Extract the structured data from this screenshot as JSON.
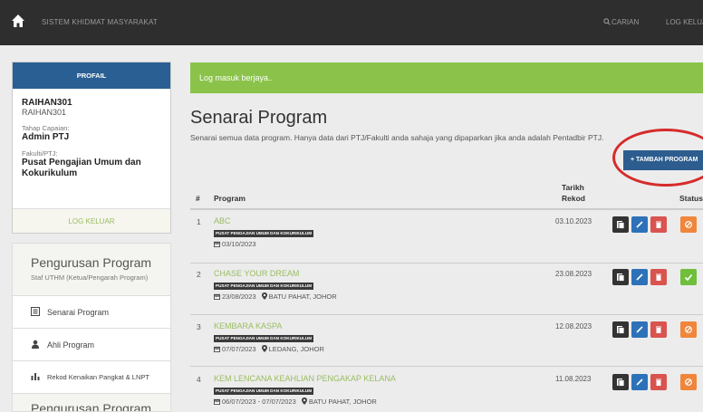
{
  "navbar": {
    "brand": "SISTEM KHIDMAT MASYARAKAT",
    "search_label": "CARIAN",
    "logout_label": "LOG KELUAR"
  },
  "profile": {
    "header": "PROFAIL",
    "username": "RAIHAN301",
    "user_id": "RAIHAN301",
    "level_label": "Tahap Capaian:",
    "level_value": "Admin PTJ",
    "faculty_label": "Fakulti/PTJ:",
    "faculty_value": "Pusat Pengajian Umum dan Kokurikulum",
    "logout": "LOG KELUAR"
  },
  "menu": {
    "section_title": "Pengurusan Program",
    "section_subtitle": "Staf UTHM (Ketua/Pengarah Program)",
    "items": [
      {
        "label": "Senarai Program",
        "icon": "list-icon"
      },
      {
        "label": "Ahli Program",
        "icon": "user-icon"
      },
      {
        "label": "Rekod Kenaikan Pangkat & LNPT",
        "icon": "bar-chart-icon"
      }
    ],
    "next_section_title": "Pengurusan Program"
  },
  "alert": "Log masuk berjaya..",
  "page": {
    "title": "Senarai Program",
    "subtitle": "Senarai semua data program. Hanya data dari PTJ/Fakulti anda sahaja yang dipaparkan jika anda adalah Pentadbir PTJ.",
    "add_button": "+ TAMBAH PROGRAM"
  },
  "table": {
    "headers": {
      "num": "#",
      "program": "Program",
      "date_line1": "Tarikh",
      "date_line2": "Rekod",
      "status": "Status"
    },
    "rows": [
      {
        "num": "1",
        "name": "ABC",
        "badge": "PUSAT PENGAJIAN UMUM DAN KOKURIKULUM",
        "meta": "03/10/2023",
        "location": "",
        "date": "03.10.2023",
        "status": "pending"
      },
      {
        "num": "2",
        "name": "CHASE YOUR DREAM",
        "badge": "PUSAT PENGAJIAN UMUM DAN KOKURIKULUM",
        "meta": "23/08/2023",
        "location": "BATU PAHAT, JOHOR",
        "date": "23.08.2023",
        "status": "approved"
      },
      {
        "num": "3",
        "name": "KEMBARA KASPA",
        "badge": "PUSAT PENGAJIAN UMUM DAN KOKURIKULUM",
        "meta": "07/07/2023",
        "location": "LEDANG, JOHOR",
        "date": "12.08.2023",
        "status": "pending"
      },
      {
        "num": "4",
        "name": "KEM LENCANA KEAHLIAN PENGAKAP KELANA",
        "badge": "PUSAT PENGAJIAN UMUM DAN KOKURIKULUM",
        "meta": "06/07/2023 - 07/07/2023",
        "location": "BATU PAHAT, JOHOR",
        "date": "11.08.2023",
        "status": "pending"
      }
    ]
  },
  "colors": {
    "navbar": "#2e2e2e",
    "accent_green": "#8bc34a",
    "link_green": "#9abd60",
    "primary_blue": "#2d5c8e",
    "annotation_red": "#d62b2b"
  }
}
